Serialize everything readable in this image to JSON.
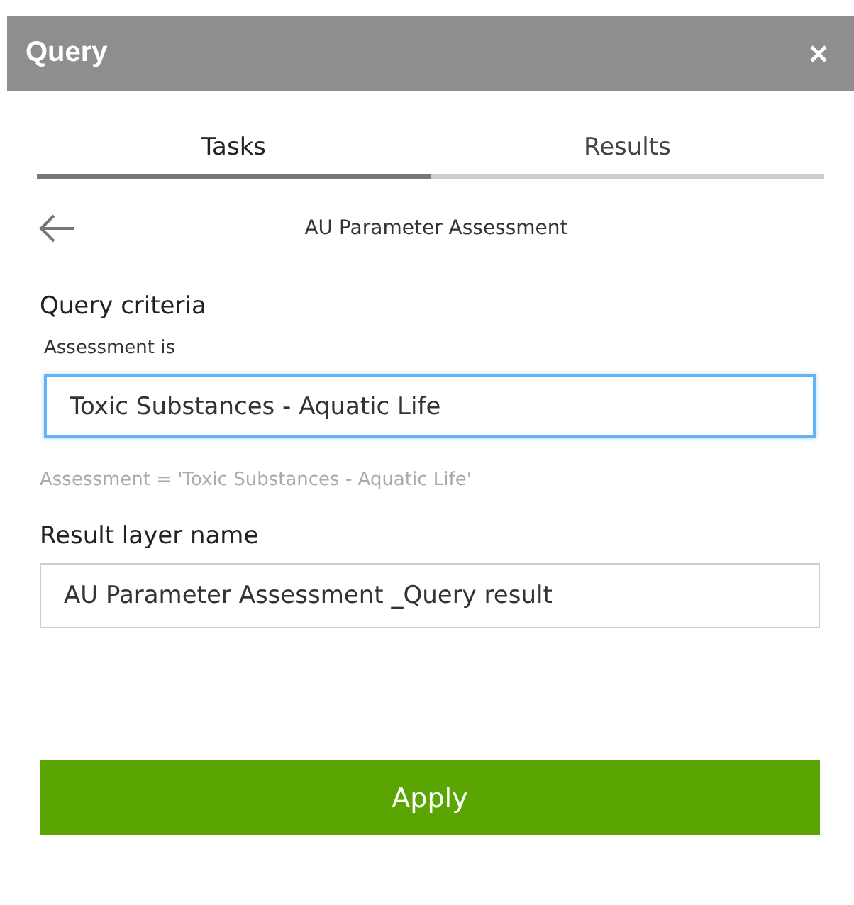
{
  "window": {
    "title": "Query"
  },
  "tabs": [
    {
      "label": "Tasks",
      "selected": true
    },
    {
      "label": "Results",
      "selected": false
    }
  ],
  "task_title": "AU Parameter Assessment",
  "criteria": {
    "heading": "Query criteria",
    "label": "Assessment is",
    "value": "Toxic Substances - Aquatic Life",
    "focused": true,
    "expression": "Assessment = 'Toxic Substances - Aquatic Life'"
  },
  "result_layer": {
    "heading": "Result layer name",
    "value": "AU Parameter Assessment _Query result"
  },
  "apply_button": "Apply"
}
